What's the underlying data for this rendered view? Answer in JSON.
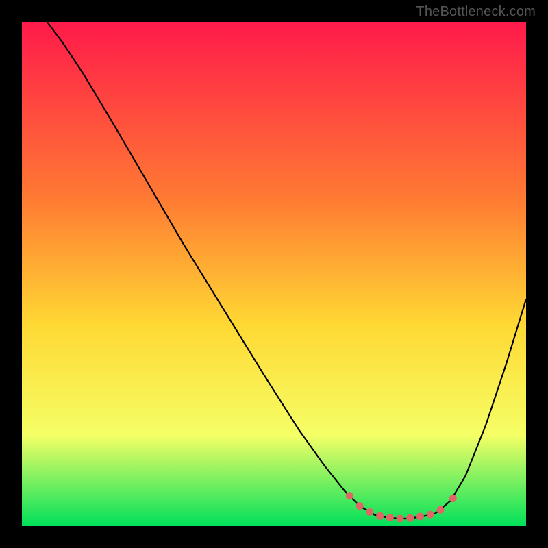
{
  "watermark": "TheBottleneck.com",
  "colors": {
    "background": "#000000",
    "gradient_top": "#ff1a4a",
    "gradient_mid1": "#ff7a33",
    "gradient_mid2": "#ffd833",
    "gradient_mid3": "#f5ff66",
    "gradient_bottom": "#00e05a",
    "curve": "#000000",
    "dots": "#e06666"
  },
  "chart_data": {
    "type": "line",
    "title": "",
    "xlabel": "",
    "ylabel": "",
    "xlim": [
      0,
      100
    ],
    "ylim": [
      0,
      100
    ],
    "curve_points": [
      {
        "x": 5,
        "y": 100
      },
      {
        "x": 8,
        "y": 96
      },
      {
        "x": 12,
        "y": 90
      },
      {
        "x": 18,
        "y": 80
      },
      {
        "x": 25,
        "y": 68
      },
      {
        "x": 32,
        "y": 56
      },
      {
        "x": 40,
        "y": 43
      },
      {
        "x": 48,
        "y": 30
      },
      {
        "x": 55,
        "y": 19
      },
      {
        "x": 60,
        "y": 12
      },
      {
        "x": 64,
        "y": 7
      },
      {
        "x": 67,
        "y": 4
      },
      {
        "x": 70,
        "y": 2.2
      },
      {
        "x": 73,
        "y": 1.6
      },
      {
        "x": 76,
        "y": 1.5
      },
      {
        "x": 79,
        "y": 1.8
      },
      {
        "x": 82,
        "y": 2.5
      },
      {
        "x": 85,
        "y": 5
      },
      {
        "x": 88,
        "y": 10
      },
      {
        "x": 92,
        "y": 20
      },
      {
        "x": 96,
        "y": 32
      },
      {
        "x": 100,
        "y": 45
      }
    ],
    "marker_points": [
      {
        "x": 65,
        "y": 6
      },
      {
        "x": 67,
        "y": 4
      },
      {
        "x": 69,
        "y": 2.8
      },
      {
        "x": 71,
        "y": 2.0
      },
      {
        "x": 73,
        "y": 1.7
      },
      {
        "x": 75,
        "y": 1.5
      },
      {
        "x": 77,
        "y": 1.6
      },
      {
        "x": 79,
        "y": 1.9
      },
      {
        "x": 81,
        "y": 2.3
      },
      {
        "x": 83,
        "y": 3.2
      },
      {
        "x": 85.5,
        "y": 5.5
      }
    ]
  }
}
